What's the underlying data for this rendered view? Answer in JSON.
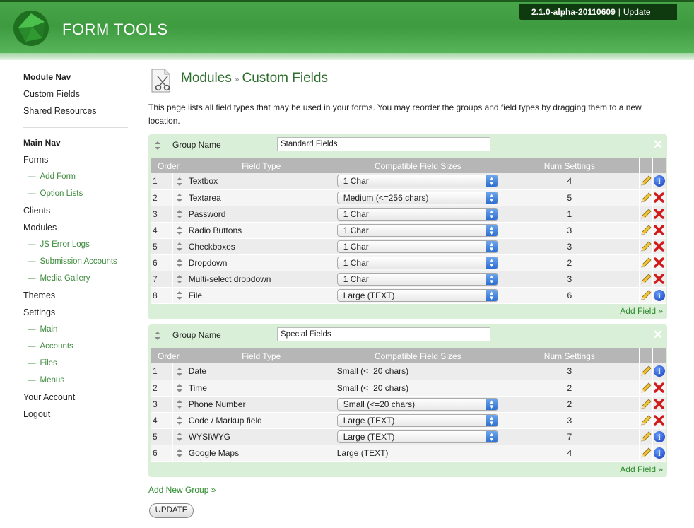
{
  "header": {
    "logo_text": "FORM TOOLS",
    "version": "2.1.0-alpha-20110609",
    "separator": "|",
    "update_link": "Update"
  },
  "sidebar": {
    "module_nav_heading": "Module Nav",
    "module_nav": [
      "Custom Fields",
      "Shared Resources"
    ],
    "main_nav_heading": "Main Nav",
    "main_nav": [
      {
        "label": "Forms",
        "level": 0
      },
      {
        "label": "Add Form",
        "level": 1
      },
      {
        "label": "Option Lists",
        "level": 1
      },
      {
        "label": "Clients",
        "level": 0
      },
      {
        "label": "Modules",
        "level": 0
      },
      {
        "label": "JS Error Logs",
        "level": 1
      },
      {
        "label": "Submission Accounts",
        "level": 1
      },
      {
        "label": "Media Gallery",
        "level": 1
      },
      {
        "label": "Themes",
        "level": 0
      },
      {
        "label": "Settings",
        "level": 0
      },
      {
        "label": "Main",
        "level": 1
      },
      {
        "label": "Accounts",
        "level": 1
      },
      {
        "label": "Files",
        "level": 1
      },
      {
        "label": "Menus",
        "level": 1
      },
      {
        "label": "Your Account",
        "level": 0
      },
      {
        "label": "Logout",
        "level": 0
      }
    ],
    "sub_prefix": "—"
  },
  "page": {
    "title_part1": "Modules",
    "title_sep": "»",
    "title_part2": "Custom Fields",
    "intro": "This page lists all field types that may be used in your forms. You may reorder the groups and field types by dragging them to a new location."
  },
  "table_headers": {
    "order": "Order",
    "field_type": "Field Type",
    "sizes": "Compatible Field Sizes",
    "num_settings": "Num Settings"
  },
  "group_label": "Group Name",
  "add_field_label": "Add Field »",
  "groups": [
    {
      "name": "Standard Fields",
      "rows": [
        {
          "order": "1",
          "type": "Textbox",
          "size": "1 Char",
          "dropdown": true,
          "num": "4",
          "action": "info"
        },
        {
          "order": "2",
          "type": "Textarea",
          "size": "Medium (<=256 chars)",
          "dropdown": true,
          "num": "5",
          "action": "delete"
        },
        {
          "order": "3",
          "type": "Password",
          "size": "1 Char",
          "dropdown": true,
          "num": "1",
          "action": "delete"
        },
        {
          "order": "4",
          "type": "Radio Buttons",
          "size": "1 Char",
          "dropdown": true,
          "num": "3",
          "action": "delete"
        },
        {
          "order": "5",
          "type": "Checkboxes",
          "size": "1 Char",
          "dropdown": true,
          "num": "3",
          "action": "delete"
        },
        {
          "order": "6",
          "type": "Dropdown",
          "size": "1 Char",
          "dropdown": true,
          "num": "2",
          "action": "delete"
        },
        {
          "order": "7",
          "type": "Multi-select dropdown",
          "size": "1 Char",
          "dropdown": true,
          "num": "3",
          "action": "delete"
        },
        {
          "order": "8",
          "type": "File",
          "size": "Large (TEXT)",
          "dropdown": true,
          "num": "6",
          "action": "info"
        }
      ]
    },
    {
      "name": "Special Fields",
      "rows": [
        {
          "order": "1",
          "type": "Date",
          "size": "Small (<=20 chars)",
          "dropdown": false,
          "num": "3",
          "action": "info"
        },
        {
          "order": "2",
          "type": "Time",
          "size": "Small (<=20 chars)",
          "dropdown": false,
          "num": "2",
          "action": "delete"
        },
        {
          "order": "3",
          "type": "Phone Number",
          "size": "Small (<=20 chars)",
          "dropdown": true,
          "num": "2",
          "action": "delete"
        },
        {
          "order": "4",
          "type": "Code / Markup field",
          "size": "Large (TEXT)",
          "dropdown": true,
          "num": "3",
          "action": "delete"
        },
        {
          "order": "5",
          "type": "WYSIWYG",
          "size": "Large (TEXT)",
          "dropdown": true,
          "num": "7",
          "action": "info"
        },
        {
          "order": "6",
          "type": "Google Maps",
          "size": "Large (TEXT)",
          "dropdown": false,
          "num": "4",
          "action": "info"
        }
      ]
    }
  ],
  "add_group_label": "Add New Group »",
  "update_button": "UPDATE",
  "colors": {
    "brand_green": "#3f9b40",
    "group_bg": "#d9efd7",
    "table_header": "#b6b6b6",
    "link_green": "#2e8b2e"
  }
}
